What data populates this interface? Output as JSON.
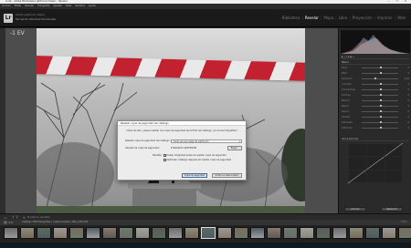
{
  "window": {
    "title": "Lrcat - Adobe Photoshop Lightroom Classic - Revelar",
    "controls": "— ☐ ✕"
  },
  "menu": [
    "Archivo",
    "Editar",
    "Revelar",
    "Fotografía",
    "Ajustes",
    "Vista",
    "Ventana",
    "Ayuda"
  ],
  "identity": {
    "logo": "Lr",
    "catalog": "Adobe Lightroom Classic",
    "user": "Fernando Sánchez Fernández"
  },
  "modules": [
    {
      "label": "Biblioteca",
      "active": false
    },
    {
      "label": "Revelar",
      "active": true
    },
    {
      "label": "Mapa",
      "active": false
    },
    {
      "label": "Libro",
      "active": false
    },
    {
      "label": "Proyección",
      "active": false
    },
    {
      "label": "Imprimir",
      "active": false
    },
    {
      "label": "Web",
      "active": false
    }
  ],
  "viewer": {
    "exposure_label": "-1 EV"
  },
  "dialog": {
    "title": "Realizar copia de seguridad del catálogo",
    "message": "Antes de salir, ¿desea realizar una copia de seguridad de la ficha del catálogo, y/o de las fotografías?",
    "backup_label": "Realizar copia de seguridad del catálogo:",
    "backup_value": "Cada vez que salga de Lightroom",
    "folder_label": "Carpeta de copia de seguridad:",
    "folder_value": "E:\\BACKUP LIGHTROOM",
    "choose_button": "Elegir...",
    "also_label": "También:",
    "check_integrity": "Probar integridad antes de realizar copia de seguridad",
    "check_optimize": "Optimizar catálogo después de realizar copia de seguridad",
    "backup_button": "Copia de seguridad",
    "skip_button": "Omitir en esta ocasión"
  },
  "right_panel": {
    "headers": [
      "Básico",
      "Curva de tonos"
    ],
    "sliders": [
      {
        "label": "Temp",
        "value": "0"
      },
      {
        "label": "Matiz",
        "value": "0"
      },
      {
        "label": "Exposición",
        "value": "-1,00"
      },
      {
        "label": "Contraste",
        "value": "0"
      },
      {
        "label": "Iluminaciones",
        "value": "0"
      },
      {
        "label": "Sombras",
        "value": "0"
      },
      {
        "label": "Blancos",
        "value": "0"
      },
      {
        "label": "Negros",
        "value": "0"
      },
      {
        "label": "Textura",
        "value": "0"
      },
      {
        "label": "Claridad",
        "value": "0"
      },
      {
        "label": "Intensidad",
        "value": "0"
      },
      {
        "label": "Saturación",
        "value": "0"
      }
    ],
    "prev_button": "Anterior",
    "reset_button": "Restaurar"
  },
  "toolbar": {
    "proofing_label": "Prueba en pantalla"
  },
  "filmbar": {
    "status": "Catálogo  1583 fotografías / 1 seleccionadas / IMG_1234.CR2",
    "filter": "Filtro:"
  },
  "colors": {
    "accent": "#ffffff",
    "dialog_bg": "#ececec",
    "panel_bg": "#2a2a2a"
  }
}
